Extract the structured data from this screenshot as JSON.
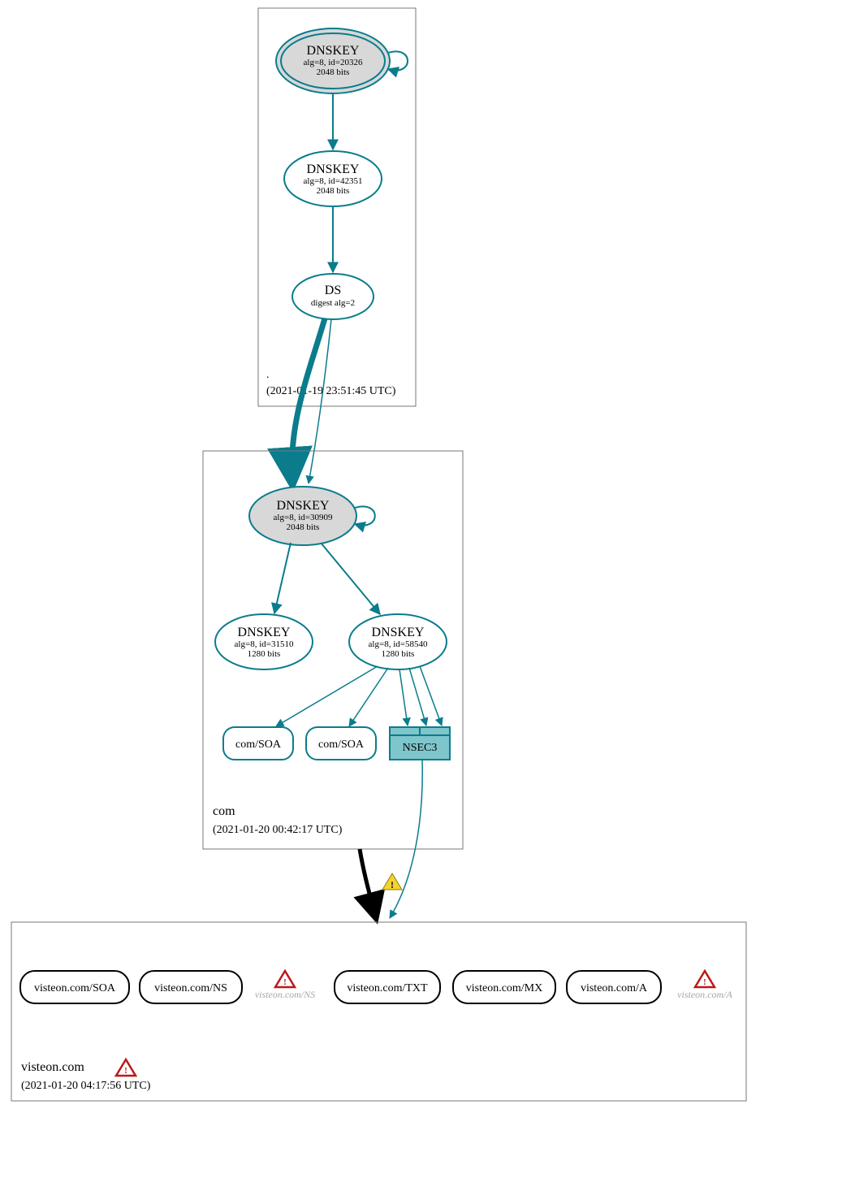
{
  "zones": {
    "root": {
      "name": ".",
      "timestamp": "(2021-01-19 23:51:45 UTC)",
      "keys": {
        "ksk": {
          "title": "DNSKEY",
          "detail": "alg=8, id=20326",
          "bits": "2048 bits"
        },
        "zsk": {
          "title": "DNSKEY",
          "detail": "alg=8, id=42351",
          "bits": "2048 bits"
        },
        "ds": {
          "title": "DS",
          "detail": "digest alg=2"
        }
      }
    },
    "com": {
      "name": "com",
      "timestamp": "(2021-01-20 00:42:17 UTC)",
      "keys": {
        "ksk": {
          "title": "DNSKEY",
          "detail": "alg=8, id=30909",
          "bits": "2048 bits"
        },
        "zsk1": {
          "title": "DNSKEY",
          "detail": "alg=8, id=31510",
          "bits": "1280 bits"
        },
        "zsk2": {
          "title": "DNSKEY",
          "detail": "alg=8, id=58540",
          "bits": "1280 bits"
        }
      },
      "records": {
        "soa1": "com/SOA",
        "soa2": "com/SOA",
        "nsec3": "NSEC3"
      }
    },
    "visteon": {
      "name": "visteon.com",
      "timestamp": "(2021-01-20 04:17:56 UTC)",
      "records": {
        "soa": "visteon.com/SOA",
        "ns": "visteon.com/NS",
        "ns_err": "visteon.com/NS",
        "txt": "visteon.com/TXT",
        "mx": "visteon.com/MX",
        "a": "visteon.com/A",
        "a_err": "visteon.com/A"
      }
    }
  },
  "colors": {
    "teal": "#0a7c8c",
    "fill_gray": "#d8d8d8",
    "fill_teal": "#7ec5cc",
    "error_red": "#bb1919",
    "warn_yellow": "#f3d332",
    "gray_text": "#a6a6a6",
    "black": "#000000"
  }
}
